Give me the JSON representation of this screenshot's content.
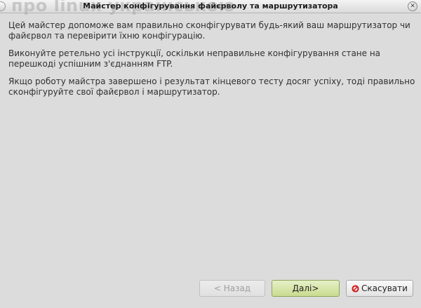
{
  "window": {
    "title": "Майстер конфігурування файєрволу та маршрутизатора",
    "watermark": "про linux українською"
  },
  "content": {
    "paragraphs": [
      "Цей майстер допоможе вам правильно сконфігурувати будь-який ваш маршрутизатор чи файєрвол та перевірити їхню конфігурацію.",
      "Виконуйте ретельно усі інструкції, оскільки неправильне конфігурування стане на перешкоді успішним з'єднанням FTP.",
      "Якщо роботу майстра завершено і результат кінцевого тесту досяг успіху, тоді правильно сконфігуруйте свої файєрвол і маршрутизатор."
    ]
  },
  "buttons": {
    "back_label": "< Назад",
    "next_label": "Далі>",
    "cancel_label": "Скасувати"
  },
  "icons": {
    "cancel": "cancel-icon",
    "close": "close-icon"
  },
  "colors": {
    "next_button": "#c9dc8f",
    "cancel_icon": "#cc1e1e"
  }
}
